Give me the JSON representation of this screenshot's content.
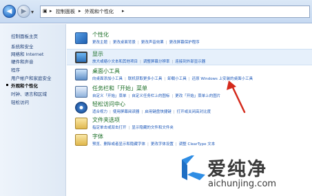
{
  "address_bar": {
    "back_label": "◀",
    "forward_label": "▶",
    "crumbs": [
      "控制面板",
      "外观和个性化"
    ],
    "crumb_arrows": [
      "▸",
      "▸",
      "▸"
    ]
  },
  "sidebar": {
    "items": [
      "控制面板主页",
      "系统和安全",
      "网络和 Internet",
      "硬件和声音",
      "程序",
      "用户帐户和家庭安全",
      "外观和个性化",
      "时钟、语言和区域",
      "轻松访问"
    ],
    "current_index": 6
  },
  "categories": [
    {
      "title": "个性化",
      "icon": "personalization-icon",
      "links": [
        "更改主题",
        "更改桌面背景",
        "更改声音效果",
        "更改屏幕保护程序"
      ]
    },
    {
      "title": "显示",
      "icon": "display-icon",
      "links": [
        "放大或缩小文本和其他项目",
        "调整屏幕分辨率",
        "连接到外部显示器"
      ]
    },
    {
      "title": "桌面小工具",
      "icon": "gadgets-icon",
      "links": [
        "向桌面添加小工具",
        "联机获取更多小工具",
        "卸载小工具",
        "还原 Windows 上安装的桌面小工具"
      ]
    },
    {
      "title": "任务栏和「开始」菜单",
      "icon": "taskbar-icon",
      "links": [
        "自定义「开始」菜单",
        "自定义任务栏上的图标",
        "更改「开始」菜单上的图片"
      ]
    },
    {
      "title": "轻松访问中心",
      "icon": "ease-of-access-icon",
      "links": [
        "适合视力",
        "使用屏幕阅读器",
        "启用键盘快捷键",
        "打开或关闭高对比度"
      ]
    },
    {
      "title": "文件夹选项",
      "icon": "folder-options-icon",
      "links": [
        "指定单击或双击打开",
        "显示隐藏的文件和文件夹"
      ]
    },
    {
      "title": "字体",
      "icon": "fonts-icon",
      "links": [
        "预览、删除或者显示和隐藏字体",
        "更改字体设置",
        "调整 ClearType 文本"
      ]
    }
  ],
  "watermark": {
    "text": "爱纯净",
    "url": "aichunjing.com"
  },
  "colors": {
    "category_title": "#1b6e27",
    "link": "#1a56b8",
    "sidebar_link": "#1e3e76",
    "arrow": "#d42a1c"
  }
}
